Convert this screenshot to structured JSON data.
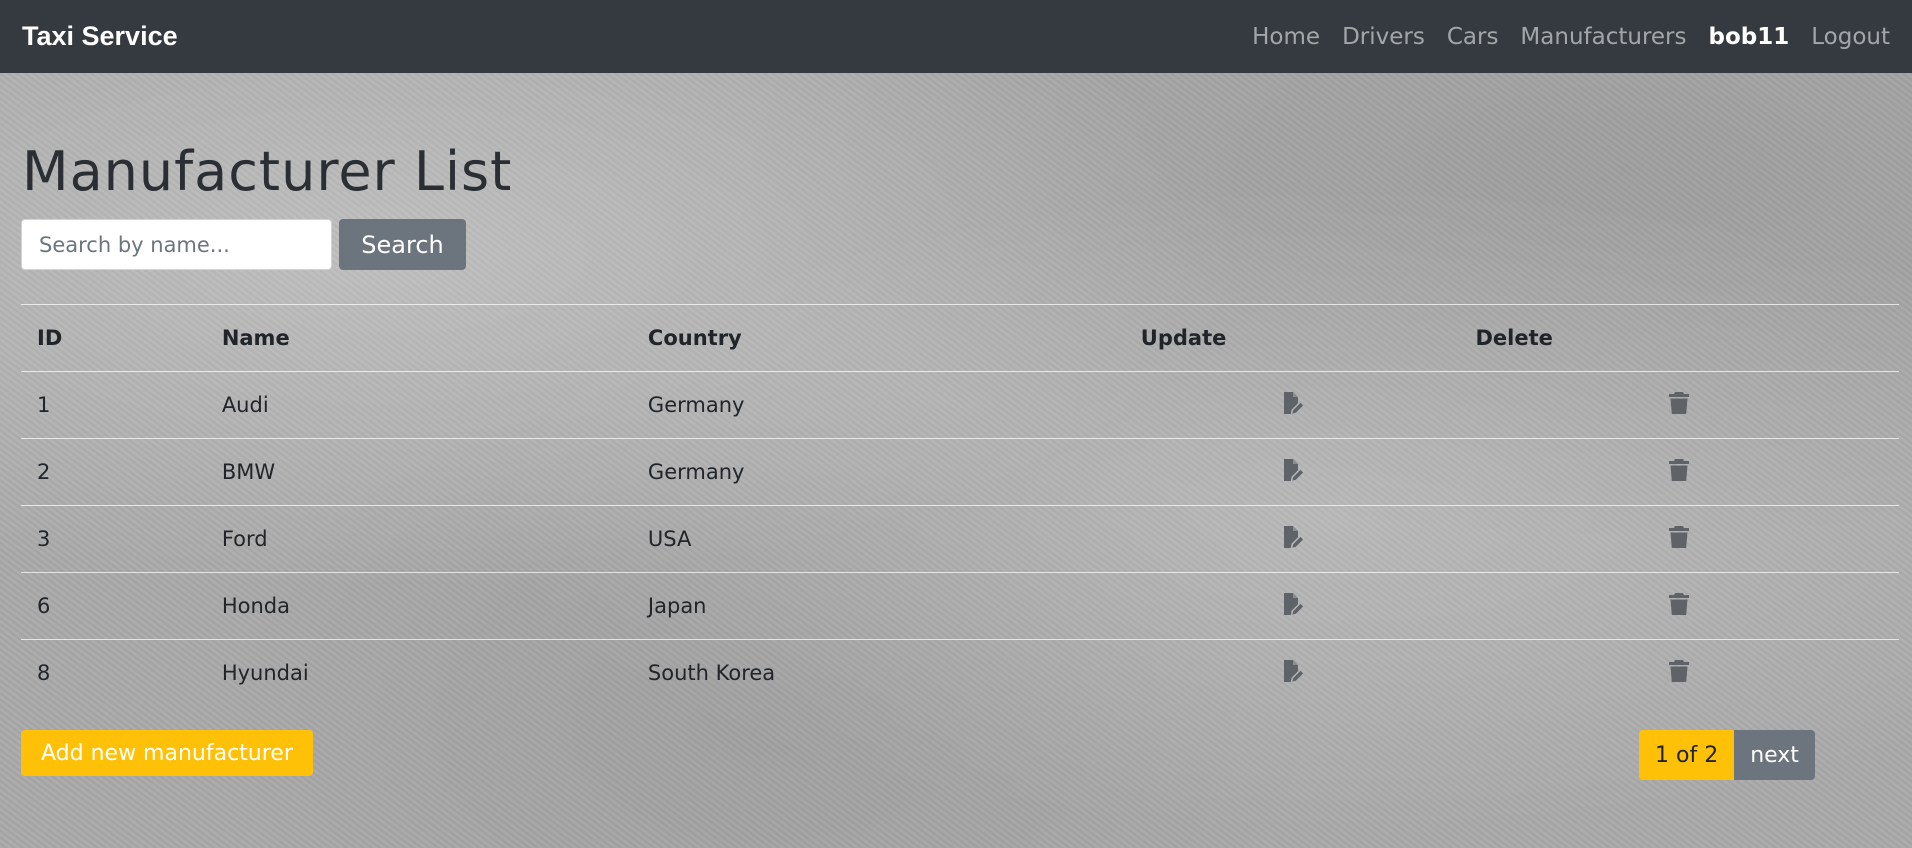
{
  "navbar": {
    "brand": "Taxi Service",
    "links": [
      "Home",
      "Drivers",
      "Cars",
      "Manufacturers"
    ],
    "user": "bob11",
    "logout": "Logout"
  },
  "page": {
    "title": "Manufacturer List"
  },
  "search": {
    "placeholder": "Search by name...",
    "button_label": "Search"
  },
  "table": {
    "headers": [
      "ID",
      "Name",
      "Country",
      "Update",
      "Delete"
    ],
    "rows": [
      {
        "id": "1",
        "name": "Audi",
        "country": "Germany"
      },
      {
        "id": "2",
        "name": "BMW",
        "country": "Germany"
      },
      {
        "id": "3",
        "name": "Ford",
        "country": "USA"
      },
      {
        "id": "6",
        "name": "Honda",
        "country": "Japan"
      },
      {
        "id": "8",
        "name": "Hyundai",
        "country": "South Korea"
      }
    ],
    "update_icon": "file-edit-icon",
    "delete_icon": "trash-icon"
  },
  "actions": {
    "add_label": "Add new manufacturer"
  },
  "pagination": {
    "current": "1 of 2",
    "next_label": "next"
  },
  "colors": {
    "navbar": "#343a40",
    "accent": "#ffc107",
    "secondary": "#6c757d"
  }
}
